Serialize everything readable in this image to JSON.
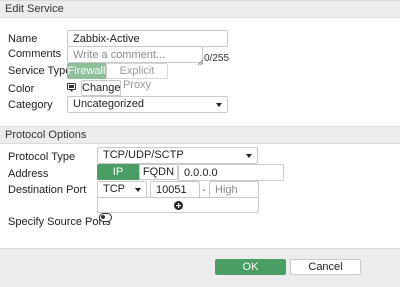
{
  "header": {
    "title": "Edit Service"
  },
  "form": {
    "name_label": "Name",
    "name_value": "Zabbix-Active",
    "comments_label": "Comments",
    "comments_placeholder": "Write a comment...",
    "comments_counter": "0/255",
    "service_type_label": "Service Type",
    "service_type_options": [
      "Firewall",
      "Explicit Proxy"
    ],
    "service_type_selected": "Firewall",
    "color_label": "Color",
    "color_change_label": "Change",
    "category_label": "Category",
    "category_value": "Uncategorized"
  },
  "protocol": {
    "section_title": "Protocol Options",
    "protocol_type_label": "Protocol Type",
    "protocol_type_value": "TCP/UDP/SCTP",
    "address_label": "Address",
    "address_options": [
      "IP Range",
      "FQDN"
    ],
    "address_selected": "IP Range",
    "address_value": "0.0.0.0",
    "destination_port_label": "Destination Port",
    "port_protocol_value": "TCP",
    "port_low_value": "10051",
    "port_separator": "-",
    "port_high_placeholder": "High",
    "specify_source_ports_label": "Specify Source Ports",
    "specify_source_ports_enabled": false
  },
  "footer": {
    "ok_label": "OK",
    "cancel_label": "Cancel"
  },
  "colors": {
    "accent": "#4a9e64",
    "accent_light": "#8dbf9b",
    "header_bg": "#ececec"
  }
}
